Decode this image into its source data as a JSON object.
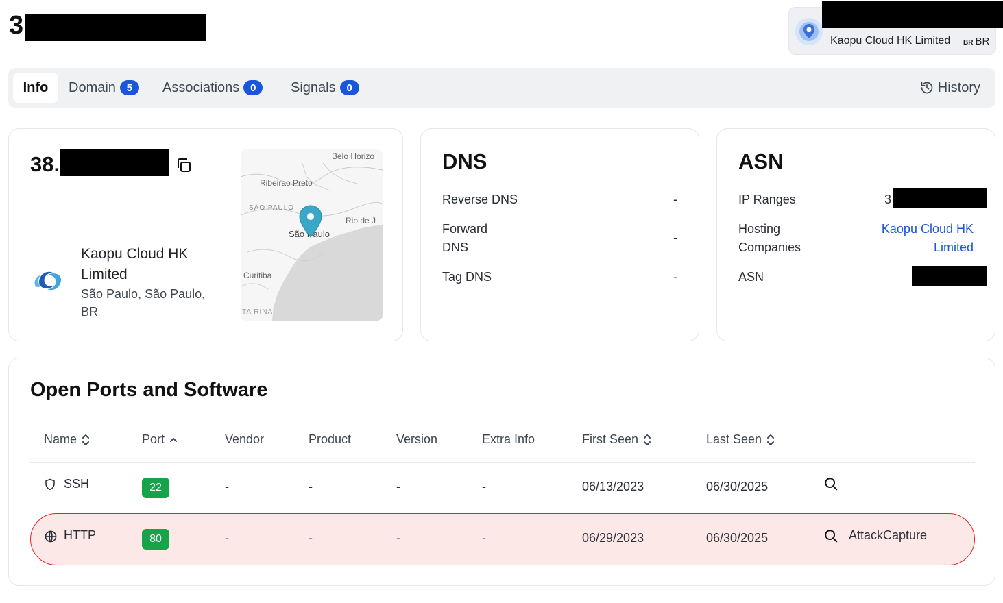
{
  "header": {
    "ip_visible": "3",
    "provider_chip": {
      "name": "Kaopu Cloud HK Limited",
      "cc_small": "BR",
      "cc": "BR"
    }
  },
  "tabs": [
    {
      "label": "Info"
    },
    {
      "label": "Domain",
      "count": "5"
    },
    {
      "label": "Associations",
      "count": "0"
    },
    {
      "label": "Signals",
      "count": "0"
    }
  ],
  "history_label": "History",
  "ip_card": {
    "ip_visible": "38.",
    "org_name": "Kaopu Cloud HK Limited",
    "org_location": "São Paulo, São Paulo, BR",
    "map_labels": {
      "belo": "Belo Horizo",
      "ribeirao": "Ribeirao Preto",
      "sao_paulo_state": "SÃO PAULO",
      "sao_paulo_city": "São Paulo",
      "rio": "Rio de J",
      "curitiba": "Curitiba",
      "catarina": "TA RINA"
    }
  },
  "dns": {
    "title": "DNS",
    "rows": [
      {
        "label": "Reverse DNS",
        "value": "-"
      },
      {
        "label": "Forward DNS",
        "value": "-"
      },
      {
        "label": "Tag DNS",
        "value": "-"
      }
    ]
  },
  "asn": {
    "title": "ASN",
    "ip_ranges_label": "IP Ranges",
    "ip_ranges_visible": "3",
    "hosting_label": "Hosting Companies",
    "hosting_value": "Kaopu Cloud HK Limited",
    "asn_label": "ASN"
  },
  "ports": {
    "title": "Open Ports and Software",
    "columns": [
      "Name",
      "Port",
      "Vendor",
      "Product",
      "Version",
      "Extra Info",
      "First Seen",
      "Last Seen"
    ],
    "rows": [
      {
        "name": "SSH",
        "icon": "shield-icon",
        "port": "22",
        "vendor": "-",
        "product": "-",
        "version": "-",
        "extra": "-",
        "first_seen": "06/13/2023",
        "last_seen": "06/30/2025",
        "tag": ""
      },
      {
        "name": "HTTP",
        "icon": "globe-icon",
        "port": "80",
        "vendor": "-",
        "product": "-",
        "version": "-",
        "extra": "-",
        "first_seen": "06/29/2023",
        "last_seen": "06/30/2025",
        "tag": "AttackCapture"
      }
    ]
  }
}
